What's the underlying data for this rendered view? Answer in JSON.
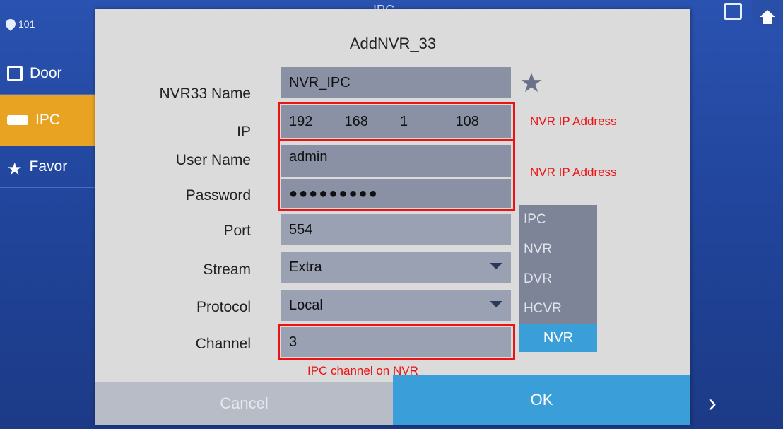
{
  "topbar": {
    "title": "IPC",
    "location": "101"
  },
  "sidebar": {
    "items": [
      {
        "label": "Door",
        "icon": "door-icon"
      },
      {
        "label": "IPC",
        "icon": "camera-icon",
        "active": true
      },
      {
        "label": "Favor",
        "icon": "star-icon"
      }
    ]
  },
  "dialog": {
    "title": "AddNVR_33",
    "fields": {
      "name": {
        "label": "NVR33 Name",
        "value": "NVR_IPC"
      },
      "ip": {
        "label": "IP",
        "parts": [
          "192",
          "168",
          "1",
          "108"
        ]
      },
      "username": {
        "label": "User Name",
        "value": "admin"
      },
      "password": {
        "label": "Password",
        "value": "●●●●●●●●●"
      },
      "port": {
        "label": "Port",
        "value": "554"
      },
      "stream": {
        "label": "Stream",
        "value": "Extra"
      },
      "protocol": {
        "label": "Protocol",
        "value": "Local"
      },
      "channel": {
        "label": "Channel",
        "value": "3"
      }
    },
    "device_types": [
      "IPC",
      "NVR",
      "DVR",
      "HCVR"
    ],
    "device_type_selected": "NVR",
    "buttons": {
      "cancel": "Cancel",
      "ok": "OK"
    }
  },
  "annotations": {
    "ip": "NVR IP Address",
    "credentials": "NVR IP Address",
    "channel": "IPC channel on NVR"
  },
  "colors": {
    "annotation": "#e11111",
    "accent": "#3a9ed8",
    "active_tab": "#e9a322"
  }
}
